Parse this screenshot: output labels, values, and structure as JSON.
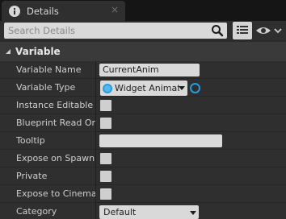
{
  "tab": {
    "title": "Details",
    "icon": "info-icon"
  },
  "search": {
    "placeholder": "Search Details",
    "value": ""
  },
  "toolbar": {
    "list_icon": "list-view-icon",
    "eye_icon": "eye-icon"
  },
  "category": {
    "title": "Variable",
    "expanded": true
  },
  "properties": {
    "variable_name": {
      "label": "Variable Name",
      "value": "CurrentAnim"
    },
    "variable_type": {
      "label": "Variable Type",
      "value": "Widget Animati",
      "pin_color": "#2a9ad8"
    },
    "instance_editable": {
      "label": "Instance Editable",
      "checked": false
    },
    "blueprint_read_only": {
      "label": "Blueprint Read Only",
      "checked": false
    },
    "tooltip": {
      "label": "Tooltip",
      "value": ""
    },
    "expose_on_spawn": {
      "label": "Expose on Spawn",
      "checked": false
    },
    "private": {
      "label": "Private",
      "checked": false
    },
    "expose_to_cinematics": {
      "label": "Expose to Cinemati",
      "checked": false
    },
    "category": {
      "label": "Category",
      "value": "Default"
    }
  },
  "colors": {
    "background": "#2a2a2a",
    "row": "#2f2f2f",
    "header": "#3a3a3a",
    "field": "#d9d9d9",
    "accent": "#2a9ad8"
  }
}
